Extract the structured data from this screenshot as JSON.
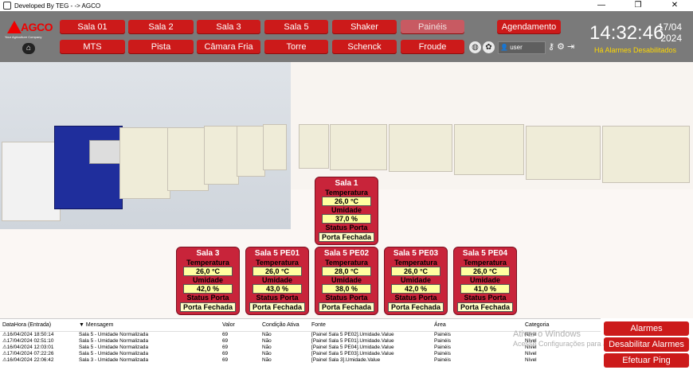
{
  "titlebar": {
    "title": "Developed By TEG - -> AGCO",
    "minimize": "—",
    "maximize": "❐",
    "close": "✕"
  },
  "logo": {
    "brand": "AGCO",
    "tagline": "Your Agriculture Company"
  },
  "nav": {
    "row1": [
      "Sala 01",
      "Sala 2",
      "Sala 3",
      "Sala 5",
      "Shaker",
      "Painéis"
    ],
    "row2": [
      "MTS",
      "Pista",
      "Câmara Fria",
      "Torre",
      "Schenck",
      "Froude"
    ]
  },
  "agendamento": "Agendamento",
  "user": {
    "name": "user"
  },
  "clock": {
    "time": "14:32:46",
    "day": "17/04",
    "year": "2024"
  },
  "alarm_status": "Há Alarmes Desabilitados",
  "panels": [
    {
      "title": "Sala 1",
      "temp_label": "Temperatura",
      "temp": "26,0 °C",
      "hum_label": "Umidade",
      "hum": "37,0 %",
      "door_label": "Status Porta",
      "door": "Porta Fechada"
    },
    {
      "title": "Sala 3",
      "temp_label": "Temperatura",
      "temp": "26,0 °C",
      "hum_label": "Umidade",
      "hum": "42,0 %",
      "door_label": "Status Porta",
      "door": "Porta Fechada"
    },
    {
      "title": "Sala 5 PE01",
      "temp_label": "Temperatura",
      "temp": "26,0 °C",
      "hum_label": "Umidade",
      "hum": "43,0 %",
      "door_label": "Status Porta",
      "door": "Porta Fechada"
    },
    {
      "title": "Sala 5 PE02",
      "temp_label": "Temperatura",
      "temp": "28,0 °C",
      "hum_label": "Umidade",
      "hum": "38,0 %",
      "door_label": "Status Porta",
      "door": "Porta Fechada"
    },
    {
      "title": "Sala 5 PE03",
      "temp_label": "Temperatura",
      "temp": "26,0 °C",
      "hum_label": "Umidade",
      "hum": "42,0 %",
      "door_label": "Status Porta",
      "door": "Porta Fechada"
    },
    {
      "title": "Sala 5 PE04",
      "temp_label": "Temperatura",
      "temp": "26,0 °C",
      "hum_label": "Umidade",
      "hum": "41,0 %",
      "door_label": "Status Porta",
      "door": "Porta Fechada"
    }
  ],
  "table": {
    "headers": [
      "DataHora (Entrada)",
      "▼ Mensagem",
      "Valor",
      "Condição Ativa",
      "Fonte",
      "Área",
      "Categoria"
    ],
    "rows": [
      [
        "16/04/2024 18:50:14",
        "Sala 5 - Umidade Normalizada",
        "69",
        "Não",
        "[Painel Sala 5 PE02].Umidade.Value",
        "Painéis",
        "Nível"
      ],
      [
        "17/04/2024 02:51:10",
        "Sala 5 - Umidade Normalizada",
        "69",
        "Não",
        "[Painel Sala 5 PE01].Umidade.Value",
        "Painéis",
        "Nível"
      ],
      [
        "16/04/2024 12:03:01",
        "Sala 5 - Umidade Normalizada",
        "69",
        "Não",
        "[Painel Sala 5 PE04].Umidade.Value",
        "Painéis",
        "Nível"
      ],
      [
        "17/04/2024 07:22:26",
        "Sala 5 - Umidade Normalizada",
        "69",
        "Não",
        "[Painel Sala 5 PE03].Umidade.Value",
        "Painéis",
        "Nível"
      ],
      [
        "16/04/2024 22:06:42",
        "Sala 3 - Umidade Normalizada",
        "69",
        "Não",
        "[Painel Sala 3].Umidade.Value",
        "Painéis",
        "Nível"
      ]
    ]
  },
  "side_buttons": [
    "Alarmes",
    "Desabilitar Alarmes",
    "Efetuar Ping"
  ],
  "watermark": {
    "line1": "Ativar o Windows",
    "line2": "Acesse Configurações para ativar o Windows."
  }
}
